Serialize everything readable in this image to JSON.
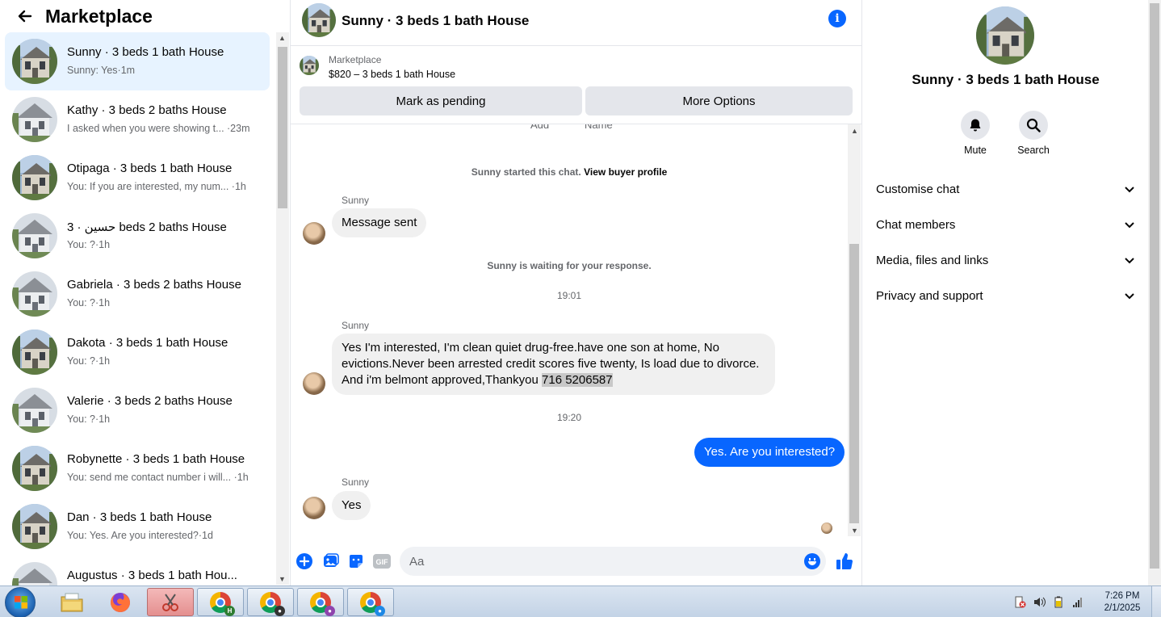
{
  "sidebar": {
    "title": "Marketplace",
    "conversations": [
      {
        "name": "Sunny · 3 beds 1 bath House",
        "preview": "Sunny: Yes·1m",
        "active": true
      },
      {
        "name": "Kathy · 3 beds 2 baths House",
        "preview": "I asked when you were showing t... ·23m"
      },
      {
        "name": "Otipaga · 3 beds 1 bath House",
        "preview": "You: If you are interested, my num... ·1h"
      },
      {
        "name": "حسين · 3 beds 2 baths House",
        "preview": "You: ?·1h"
      },
      {
        "name": "Gabriela · 3 beds 2 baths House",
        "preview": "You: ?·1h"
      },
      {
        "name": "Dakota · 3 beds 1 bath House",
        "preview": "You: ?·1h"
      },
      {
        "name": "Valerie · 3 beds 2 baths House",
        "preview": "You: ?·1h"
      },
      {
        "name": "Robynette · 3 beds 1 bath House",
        "preview": "You: send me contact number i will... ·1h"
      },
      {
        "name": "Dan · 3 beds 1 bath House",
        "preview": "You: Yes. Are you interested?·1d"
      },
      {
        "name": "Augustus · 3 beds 1 bath Hou...",
        "preview": ""
      }
    ]
  },
  "chat": {
    "title": "Sunny · 3 beds 1 bath House",
    "listing": {
      "label": "Marketplace",
      "price_title": "$820 – 3 beds 1 bath House",
      "pending_button": "Mark as pending",
      "more_button": "More Options"
    },
    "clipped_left": "Add",
    "clipped_right": "Name",
    "started_text": "Sunny started this chat.",
    "view_profile": "View buyer profile",
    "waiting_text": "Sunny is waiting for your response.",
    "messages": [
      {
        "sender": "Sunny",
        "text": "Message sent"
      },
      {
        "time": "19:01"
      },
      {
        "sender": "Sunny",
        "text": "Yes I'm interested, I'm clean quiet drug-free.have one son at home, No evictions.Never been arrested credit scores five twenty, Is load due to divorce. And i'm belmont approved,Thankyou",
        "phone": "716 5206587"
      },
      {
        "time": "19:20"
      },
      {
        "sender": "You",
        "text": "Yes. Are you interested?"
      },
      {
        "sender": "Sunny",
        "text": "Yes"
      }
    ],
    "composer": {
      "placeholder": "Aa"
    }
  },
  "right_panel": {
    "title": "Sunny · 3 beds 1 bath House",
    "mute_label": "Mute",
    "search_label": "Search",
    "sections": [
      "Customise chat",
      "Chat members",
      "Media, files and links",
      "Privacy and support"
    ]
  },
  "taskbar": {
    "time": "7:26 PM",
    "date": "2/1/2025"
  },
  "colors": {
    "accent": "#0866ff",
    "active_bg": "#e7f3ff",
    "bubble_in": "#f0f0f0",
    "button_bg": "#e4e6eb"
  },
  "icons": [
    "back-arrow-icon",
    "info-icon",
    "plus-icon",
    "photo-icon",
    "sticker-icon",
    "gif-icon",
    "emoji-icon",
    "like-icon",
    "bell-icon",
    "search-icon",
    "chevron-down-icon"
  ]
}
